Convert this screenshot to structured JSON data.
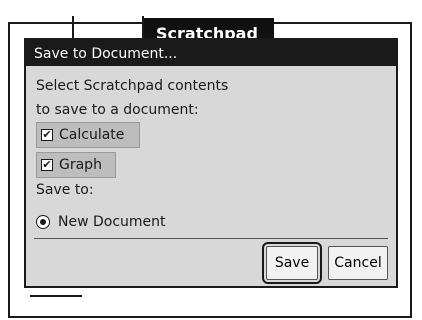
{
  "background": {
    "active_tab": "Scratchpad",
    "active_tab_caret": "▼"
  },
  "dialog": {
    "title": "Save to Document...",
    "prompt_line_1": "Select Scratchpad contents",
    "prompt_line_2": "to save to a document:",
    "options": [
      {
        "label": "Calculate",
        "checked": true
      },
      {
        "label": "Graph",
        "checked": true
      }
    ],
    "save_to_label": "Save to:",
    "destination": {
      "label": "New Document",
      "selected": true
    },
    "buttons": {
      "save_label": "Save",
      "cancel_label": "Cancel"
    }
  },
  "colors": {
    "title_bar": "#1a1a1a",
    "dialog_bg": "#d8d8d8",
    "option_highlight": "#bdbdbd"
  }
}
